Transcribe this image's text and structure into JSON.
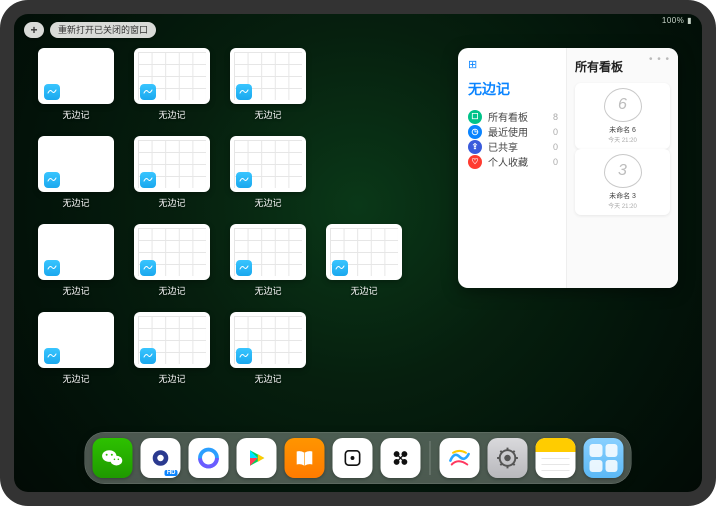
{
  "status": {
    "signal": "•••",
    "wifi": "⌔",
    "battery": "100%"
  },
  "topbar": {
    "plus": "+",
    "restore_label": "重新打开已关闭的窗口"
  },
  "thumbs": {
    "label": "无边记",
    "items": [
      {
        "style": "blank"
      },
      {
        "style": "cal"
      },
      {
        "style": "cal"
      },
      {
        "style": "blank"
      },
      {
        "style": "cal"
      },
      {
        "style": "cal"
      },
      {
        "style": "blank"
      },
      {
        "style": "cal"
      },
      {
        "style": "cal"
      },
      {
        "style": "cal"
      },
      {
        "style": "blank"
      },
      {
        "style": "cal"
      },
      {
        "style": "cal"
      }
    ]
  },
  "sidewin": {
    "menu": "• • •",
    "icon_label": "⊞",
    "title": "无边记",
    "rows": [
      {
        "icon": "teal",
        "glyph": "☐",
        "label": "所有看板",
        "count": "8"
      },
      {
        "icon": "blue",
        "glyph": "◷",
        "label": "最近使用",
        "count": "0"
      },
      {
        "icon": "navy",
        "glyph": "⇪",
        "label": "已共享",
        "count": "0"
      },
      {
        "icon": "red",
        "glyph": "♡",
        "label": "个人收藏",
        "count": "0"
      }
    ],
    "right_title": "所有看板",
    "boards": [
      {
        "doodle": "6",
        "name": "未命名 6",
        "date": "今天 21:20"
      },
      {
        "doodle": "3",
        "name": "未命名 3",
        "date": "今天 21:20"
      }
    ]
  },
  "dock": {
    "apps": [
      {
        "name": "wechat"
      },
      {
        "name": "quark1"
      },
      {
        "name": "quark2"
      },
      {
        "name": "play"
      },
      {
        "name": "books"
      },
      {
        "name": "dice"
      },
      {
        "name": "dots"
      },
      {
        "name": "freeform"
      },
      {
        "name": "settings"
      },
      {
        "name": "notes"
      },
      {
        "name": "folder"
      }
    ]
  }
}
